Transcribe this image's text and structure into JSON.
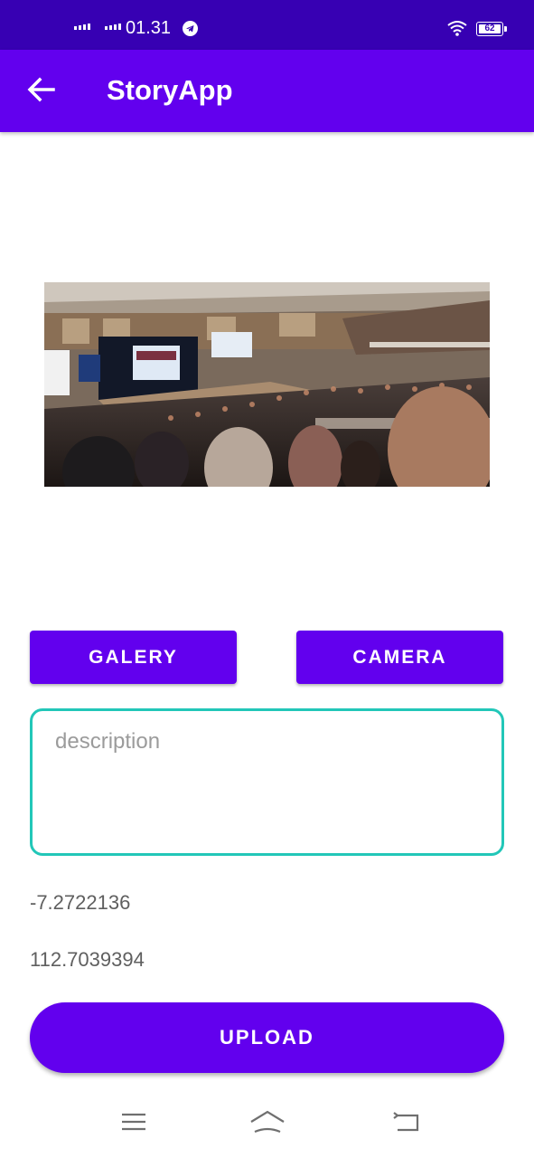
{
  "status_bar": {
    "time": "01.31",
    "battery": "62",
    "signal_icon_1": "signal-icon",
    "signal_icon_2": "signal-icon",
    "telegram_icon": "telegram-icon",
    "wifi_icon": "wifi-icon"
  },
  "app_bar": {
    "title": "StoryApp",
    "back_icon": "arrow-left-icon"
  },
  "buttons": {
    "gallery_label": "GALERY",
    "camera_label": "CAMERA",
    "upload_label": "UPLOAD"
  },
  "description": {
    "placeholder": "description",
    "value": ""
  },
  "location": {
    "latitude": "-7.2722136",
    "longitude": "112.7039394"
  },
  "nav_bar": {
    "menu_icon": "menu-icon",
    "home_icon": "home-icon",
    "back_icon": "back-nav-icon"
  },
  "colors": {
    "status_bar": "#3700b3",
    "primary": "#6200ee",
    "input_border": "#22c7b8"
  }
}
